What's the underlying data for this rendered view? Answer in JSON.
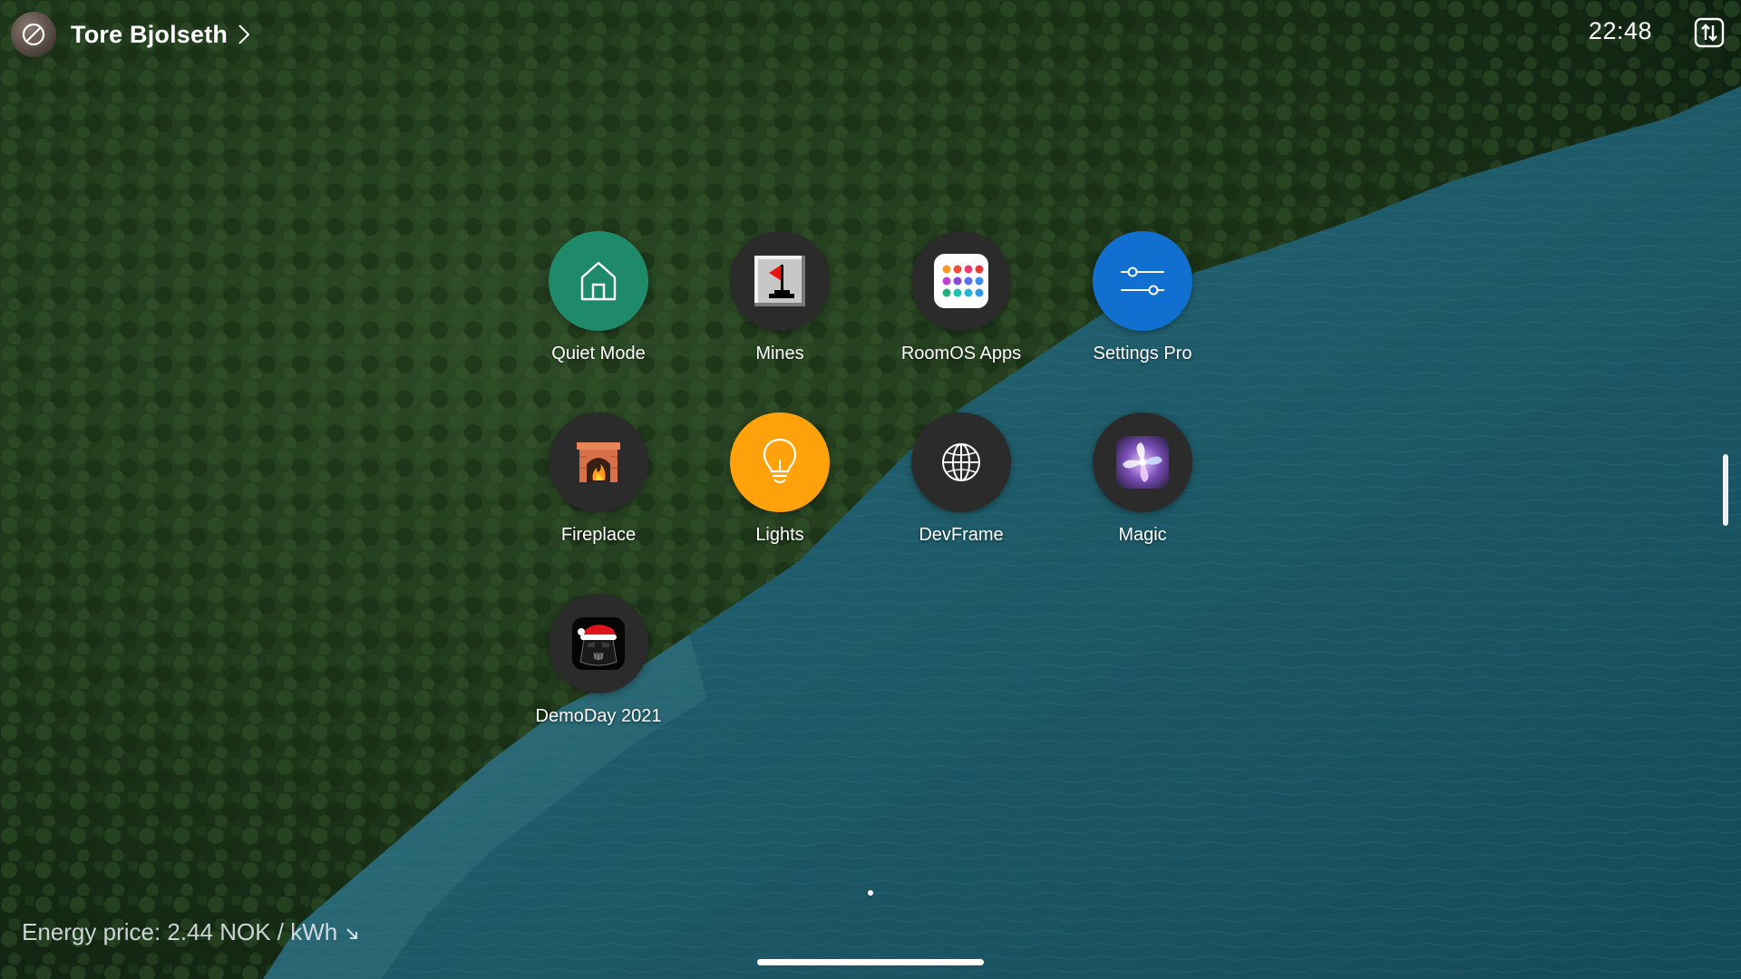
{
  "user": {
    "name": "Tore Bjolseth"
  },
  "clock": {
    "time": "22:48"
  },
  "apps": [
    {
      "id": "quiet-mode",
      "label": "Quiet Mode",
      "icon": "home-icon",
      "color": "#1f8a6a"
    },
    {
      "id": "mines",
      "label": "Mines",
      "icon": "minesweeper-flag-icon",
      "color": "#2b2b2b"
    },
    {
      "id": "roomos-apps",
      "label": "RoomOS Apps",
      "icon": "app-grid-icon",
      "color": "#2b2b2b"
    },
    {
      "id": "settings-pro",
      "label": "Settings Pro",
      "icon": "sliders-icon",
      "color": "#1170cf"
    },
    {
      "id": "fireplace",
      "label": "Fireplace",
      "icon": "fireplace-icon",
      "color": "#2b2b2b"
    },
    {
      "id": "lights",
      "label": "Lights",
      "icon": "lightbulb-icon",
      "color": "#ffa10a"
    },
    {
      "id": "devframe",
      "label": "DevFrame",
      "icon": "globe-icon",
      "color": "#2b2b2b"
    },
    {
      "id": "magic",
      "label": "Magic",
      "icon": "magic-swirl-icon",
      "color": "#2b2b2b"
    },
    {
      "id": "demoday-2021",
      "label": "DemoDay 2021",
      "icon": "darth-vader-santa-icon",
      "color": "#2b2b2b"
    }
  ],
  "energy": {
    "text": "Energy price: 2.44 NOK / kWh",
    "trend_icon": "trend-down-icon"
  },
  "pagination": {
    "current_page": 1,
    "total_pages": 1
  }
}
